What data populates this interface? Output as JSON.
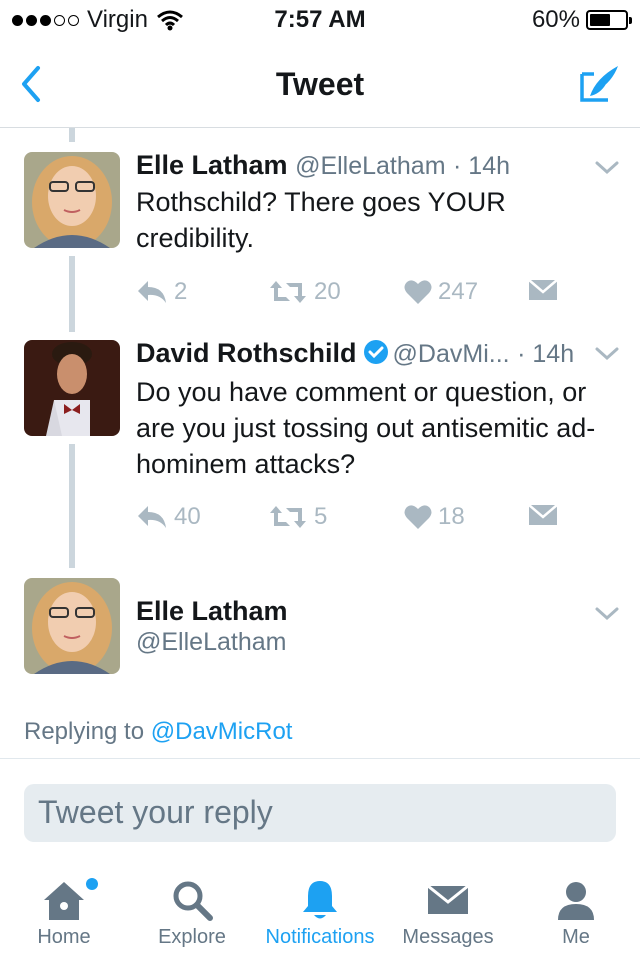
{
  "status_bar": {
    "carrier": "Virgin",
    "time": "7:57 AM",
    "battery": "60%",
    "battery_level": 0.6
  },
  "nav": {
    "title": "Tweet",
    "back_icon": "chevron-left-icon",
    "compose_icon": "compose-icon"
  },
  "tweets": [
    {
      "name": "Elle Latham",
      "handle": "@ElleLatham",
      "time": "· 14h",
      "text": "Rothschild? There goes YOUR credibility.",
      "replies": "2",
      "retweets": "20",
      "likes": "247"
    },
    {
      "name": "David Rothschild",
      "handle": "@DavMi...",
      "time": "· 14h",
      "text": "Do you have comment or question, or are you just tossing out antisemitic ad-hominem attacks?",
      "replies": "40",
      "retweets": "5",
      "likes": "18"
    }
  ],
  "composer": {
    "name": "Elle Latham",
    "handle": "@ElleLatham",
    "replying_prefix": "Replying to",
    "replying_to": "@DavMicRot",
    "placeholder": "Tweet your reply"
  },
  "tabs": [
    {
      "label": "Home",
      "icon": "home-icon"
    },
    {
      "label": "Explore",
      "icon": "search-icon"
    },
    {
      "label": "Notifications",
      "icon": "bell-icon"
    },
    {
      "label": "Messages",
      "icon": "envelope-icon"
    },
    {
      "label": "Me",
      "icon": "person-icon"
    }
  ],
  "colors": {
    "accent": "#1da1f2",
    "muted": "#657786",
    "action": "#aab8c2"
  }
}
